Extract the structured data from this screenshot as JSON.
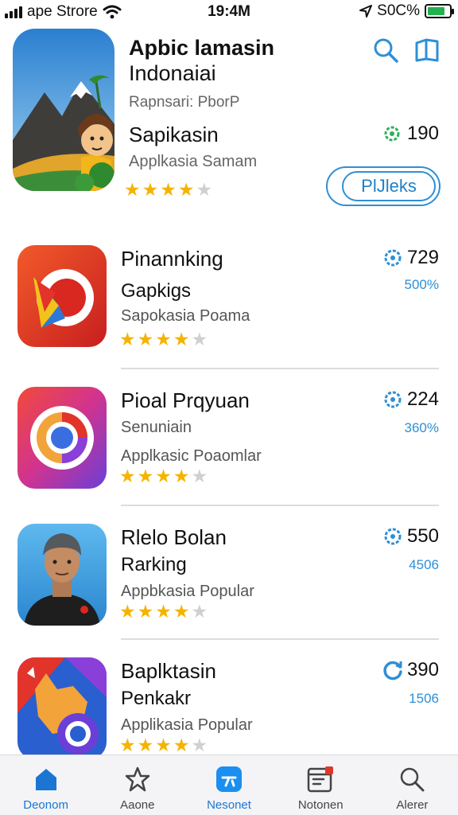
{
  "status_bar": {
    "carrier": "ape Strore",
    "time": "19:4M",
    "battery": "S0C%",
    "battery_level": 0.8
  },
  "header": {
    "title": "Apbic lamasin",
    "subtitle": "Indonaiai",
    "publisher": "Rapnsari: PborP",
    "search_icon": "search-icon",
    "share_icon": "bookmark-icon"
  },
  "featured": {
    "name": "Sapikasin",
    "category": "Applkasia Samam",
    "rating": 4,
    "stat": "190",
    "stat_icon": "gear-icon",
    "button_label": "PlJleks"
  },
  "apps": [
    {
      "title": "Pinannking",
      "subtitle": "Gapkigs",
      "category": "Sapokasia Poama",
      "rating": 4,
      "count": "729",
      "percent": "500%",
      "icon": "bird-icon",
      "stat_icon": "gear-icon"
    },
    {
      "title": "Pioal Prqyuan",
      "subtitle": "Senuniain",
      "category": "Applkasic Poaomlar",
      "rating": 4,
      "count": "224",
      "percent": "360%",
      "icon": "ring-icon",
      "stat_icon": "gear-icon"
    },
    {
      "title": "Rlelo Bolan",
      "subtitle": "Rarking",
      "category": "Appbkasia Popular",
      "rating": 4,
      "count": "550",
      "percent": "4506",
      "icon": "person-photo",
      "stat_icon": "gear-icon"
    },
    {
      "title": "Baplktasin",
      "subtitle": "Penkakr",
      "category": "Applikasia Popular",
      "rating": 4,
      "count": "390",
      "percent": "1506",
      "icon": "fox-icon",
      "stat_icon": "refresh-icon"
    }
  ],
  "tabs": [
    {
      "label": "Deonom",
      "icon": "home-icon"
    },
    {
      "label": "Aaone",
      "icon": "star-icon"
    },
    {
      "label": "Nesonet",
      "icon": "apps-icon"
    },
    {
      "label": "Notonen",
      "icon": "calendar-icon"
    },
    {
      "label": "Alerer",
      "icon": "search-icon"
    }
  ],
  "colors": {
    "accent": "#2e8fd6",
    "star": "#f5b300",
    "tab_active": "#1a76d2"
  }
}
